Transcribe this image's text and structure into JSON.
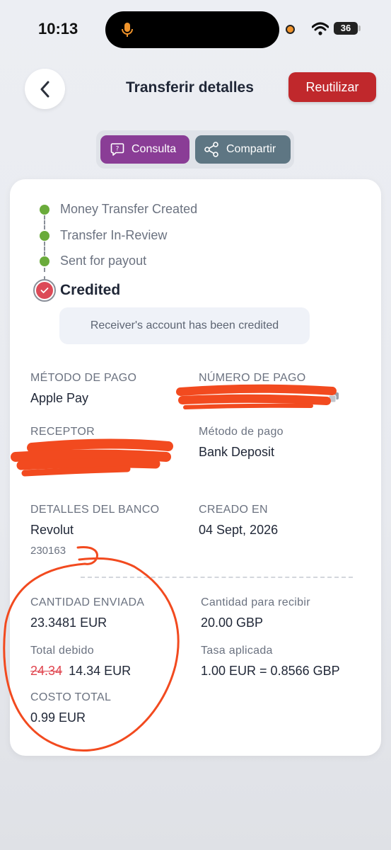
{
  "status_bar": {
    "time": "10:13",
    "battery": "36",
    "icons": [
      "microphone-icon",
      "wifi-icon",
      "battery-icon"
    ]
  },
  "header": {
    "title": "Transferir detalles",
    "back_icon": "chevron-left-icon",
    "reuse_label": "Reutilizar"
  },
  "actions": {
    "consulta_label": "Consulta",
    "consulta_icon": "chat-bubble-icon",
    "compartir_label": "Compartir",
    "compartir_icon": "share-icon"
  },
  "timeline": {
    "steps": [
      {
        "label": "Money Transfer Created",
        "status": "done"
      },
      {
        "label": "Transfer In-Review",
        "status": "done"
      },
      {
        "label": "Sent for payout",
        "status": "done"
      },
      {
        "label": "Credited",
        "status": "current"
      }
    ],
    "note": "Receiver's account has been credited"
  },
  "details": {
    "payment_method_label": "MÉTODO DE PAGO",
    "payment_method_value": "Apple Pay",
    "payment_number_label": "NÚMERO DE PAGO",
    "payment_number_value": "",
    "receiver_label": "RECEPTOR",
    "receiver_value": "",
    "delivery_method_label": "Método de pago",
    "delivery_method_value": "Bank Deposit",
    "bank_details_label": "DETALLES DEL BANCO",
    "bank_name": "Revolut",
    "bank_code": "230163",
    "created_label": "CREADO EN",
    "created_value": "04 Sept, 2026"
  },
  "amounts": {
    "sent_label": "CANTIDAD ENVIADA",
    "sent_value": "23.3481 EUR",
    "receive_label": "Cantidad para recibir",
    "receive_value": "20.00 GBP",
    "total_due_label": "Total debido",
    "total_due_original": "24.34",
    "total_due_value": "14.34 EUR",
    "rate_label": "Tasa aplicada",
    "rate_value": "1.00 EUR = 0.8566 GBP",
    "total_cost_label": "COSTO TOTAL",
    "total_cost_value": "0.99 EUR"
  },
  "colors": {
    "reuse": "#c0282c",
    "consulta": "#8a3d96",
    "compartir": "#5e7683",
    "step_done": "#6aab3b",
    "step_current": "#dc4a57",
    "redaction": "#f24a1f"
  }
}
